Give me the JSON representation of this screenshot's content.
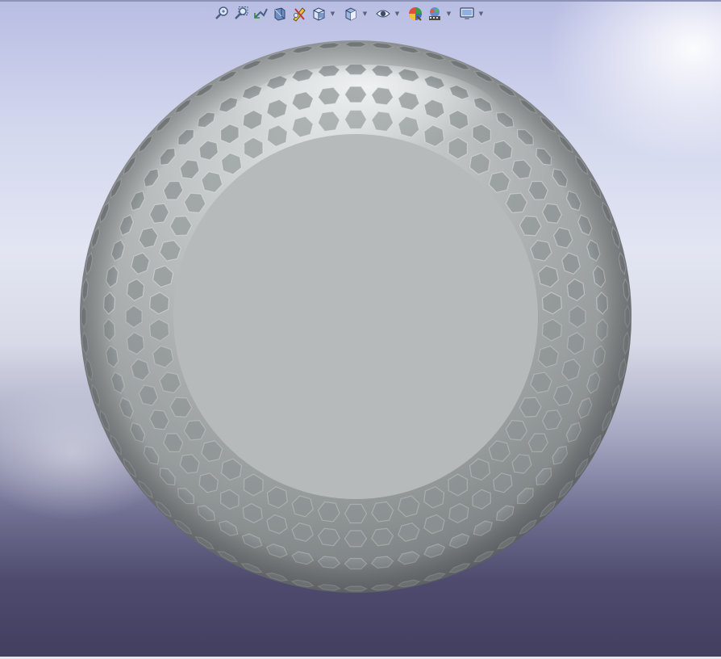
{
  "viewport": {
    "background_top": "#b8bde3",
    "background_mid": "#e2e5f2",
    "background_bottom": "#423e60"
  },
  "toolbar": {
    "items": [
      {
        "name": "zoom-to-fit-icon",
        "dropdown": false
      },
      {
        "name": "zoom-to-area-icon",
        "dropdown": false
      },
      {
        "name": "previous-view-icon",
        "dropdown": false
      },
      {
        "name": "section-view-icon",
        "dropdown": false
      },
      {
        "name": "dynamic-annotation-views-icon",
        "dropdown": false
      },
      {
        "name": "view-orientation-icon",
        "dropdown": true
      },
      {
        "name": "display-style-icon",
        "dropdown": true
      },
      {
        "name": "hide-show-items-icon",
        "dropdown": true
      },
      {
        "name": "edit-appearance-icon",
        "dropdown": false
      },
      {
        "name": "apply-scene-icon",
        "dropdown": true
      },
      {
        "name": "view-settings-icon",
        "dropdown": true
      }
    ]
  },
  "model": {
    "shape": "hollow sphere with hexagonal perforations",
    "shell_color": "#9ea3a3",
    "opening_color": "#b6babb",
    "hex_color": "#8c9293"
  }
}
